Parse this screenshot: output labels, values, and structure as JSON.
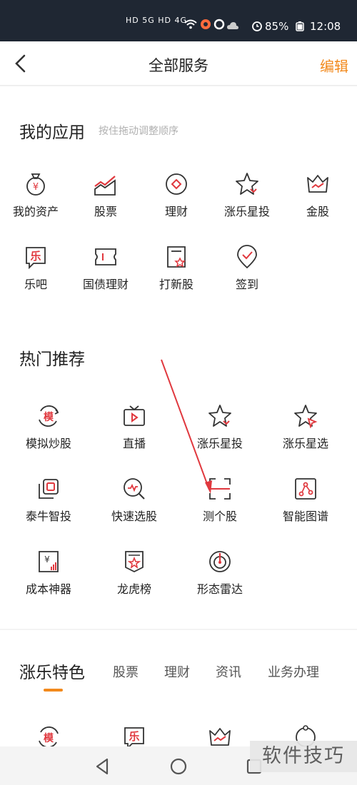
{
  "status_bar": {
    "signal_text": "HD 5G HD 4G",
    "battery": "85%",
    "time": "12:08"
  },
  "header": {
    "title": "全部服务",
    "edit_label": "编辑"
  },
  "my_apps": {
    "title": "我的应用",
    "hint": "按住拖动调整顺序",
    "items": [
      {
        "label": "我的资产",
        "icon": "money-bag-icon"
      },
      {
        "label": "股票",
        "icon": "stock-chart-icon"
      },
      {
        "label": "理财",
        "icon": "wealth-icon"
      },
      {
        "label": "涨乐星投",
        "icon": "star-icon"
      },
      {
        "label": "金股",
        "icon": "crown-icon"
      },
      {
        "label": "乐吧",
        "icon": "le-bar-icon"
      },
      {
        "label": "国债理财",
        "icon": "bond-icon"
      },
      {
        "label": "打新股",
        "icon": "new-stock-icon"
      },
      {
        "label": "签到",
        "icon": "check-in-icon"
      }
    ]
  },
  "hot": {
    "title": "热门推荐",
    "items": [
      {
        "label": "模拟炒股",
        "icon": "simulate-icon"
      },
      {
        "label": "直播",
        "icon": "tv-icon"
      },
      {
        "label": "涨乐星投",
        "icon": "star-icon"
      },
      {
        "label": "涨乐星选",
        "icon": "star-select-icon"
      },
      {
        "label": "泰牛智投",
        "icon": "smart-invest-icon"
      },
      {
        "label": "快速选股",
        "icon": "quick-select-icon"
      },
      {
        "label": "测个股",
        "icon": "scan-icon"
      },
      {
        "label": "智能图谱",
        "icon": "graph-icon"
      },
      {
        "label": "成本神器",
        "icon": "cost-tool-icon"
      },
      {
        "label": "龙虎榜",
        "icon": "dragon-tiger-icon"
      },
      {
        "label": "形态雷达",
        "icon": "radar-icon"
      }
    ]
  },
  "featured": {
    "title": "涨乐特色",
    "tabs": [
      "股票",
      "理财",
      "资讯",
      "业务办理"
    ]
  },
  "watermark": "软件技巧",
  "colors": {
    "accent": "#f2891c",
    "icon_red": "#e0383e",
    "status_bg": "#1f2733"
  }
}
